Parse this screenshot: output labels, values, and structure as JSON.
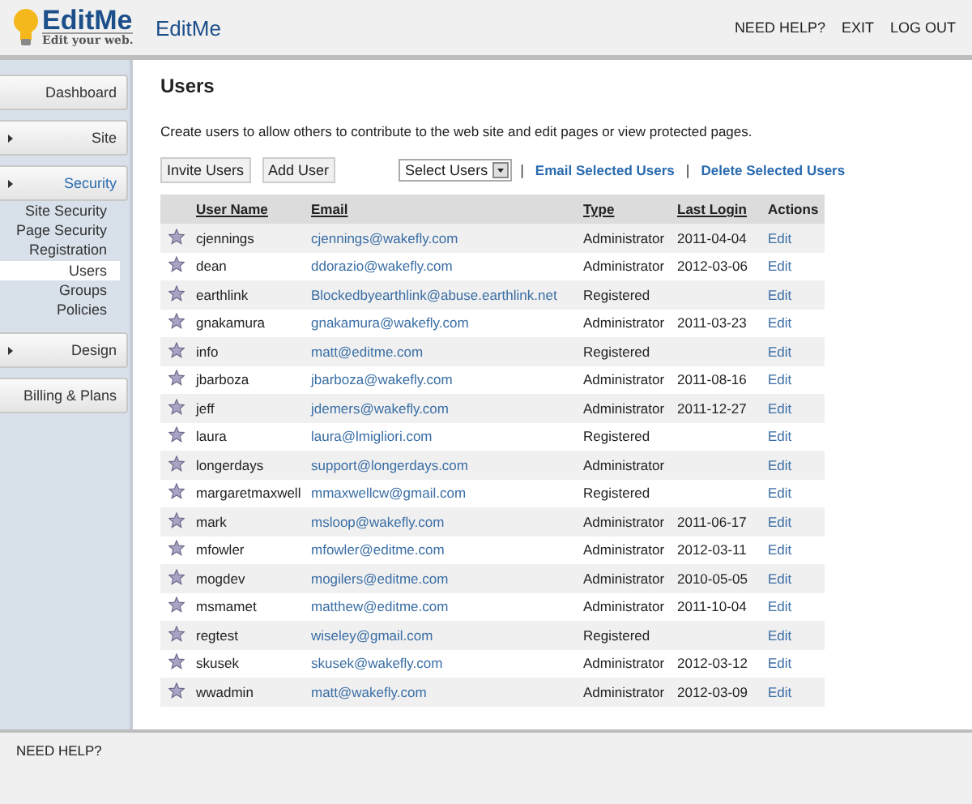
{
  "header": {
    "logo_name": "EditMe",
    "logo_tagline": "Edit your web.",
    "site_title": "EditMe",
    "links": [
      "NEED HELP?",
      "EXIT",
      "LOG OUT"
    ]
  },
  "sidebar": {
    "items": [
      {
        "label": "Dashboard",
        "kind": "link",
        "selected": false
      },
      {
        "label": "Site",
        "kind": "section",
        "selected": false
      },
      {
        "label": "Security",
        "kind": "section",
        "selected": true,
        "children": [
          {
            "label": "Site Security",
            "selected": false
          },
          {
            "label": "Page Security",
            "selected": false
          },
          {
            "label": "Registration",
            "selected": false
          },
          {
            "label": "Users",
            "selected": true
          },
          {
            "label": "Groups",
            "selected": false
          },
          {
            "label": "Policies",
            "selected": false
          }
        ]
      },
      {
        "label": "Design",
        "kind": "section",
        "selected": false
      },
      {
        "label": "Billing & Plans",
        "kind": "link",
        "selected": false
      }
    ]
  },
  "page": {
    "title": "Users",
    "description": "Create users to allow others to contribute to the web site and edit pages or view protected pages.",
    "buttons": [
      "Invite Users",
      "Add User"
    ],
    "select": "Select Users",
    "separators": [
      "|",
      "|"
    ],
    "actions": [
      "Email Selected Users",
      "Delete Selected Users"
    ]
  },
  "table": {
    "columns": [
      {
        "label": "User Name",
        "sortable": true
      },
      {
        "label": "Email",
        "sortable": true
      },
      {
        "label": "Type",
        "sortable": true
      },
      {
        "label": "Last Login",
        "sortable": true
      },
      {
        "label": "Actions",
        "sortable": false
      }
    ],
    "rows": [
      {
        "user": "cjennings",
        "email": "cjennings@wakefly.com",
        "type": "Administrator",
        "last_login": "2011-04-04",
        "action": "Edit"
      },
      {
        "user": "dean",
        "email": "ddorazio@wakefly.com",
        "type": "Administrator",
        "last_login": "2012-03-06",
        "action": "Edit"
      },
      {
        "user": "earthlink",
        "email": "Blockedbyearthlink@abuse.earthlink.net",
        "type": "Registered",
        "action": "Edit"
      },
      {
        "user": "gnakamura",
        "email": "gnakamura@wakefly.com",
        "type": "Administrator",
        "last_login": "2011-03-23",
        "action": "Edit"
      },
      {
        "user": "info",
        "email": "matt@editme.com",
        "type": "Registered",
        "action": "Edit"
      },
      {
        "user": "jbarboza",
        "email": "jbarboza@wakefly.com",
        "type": "Administrator",
        "last_login": "2011-08-16",
        "action": "Edit"
      },
      {
        "user": "jeff",
        "email": "jdemers@wakefly.com",
        "type": "Administrator",
        "last_login": "2011-12-27",
        "action": "Edit"
      },
      {
        "user": "laura",
        "email": "laura@lmigliori.com",
        "type": "Registered",
        "action": "Edit"
      },
      {
        "user": "longerdays",
        "email": "support@longerdays.com",
        "type": "Administrator",
        "action": "Edit"
      },
      {
        "user": "margaretmaxwell",
        "email": "mmaxwellcw@gmail.com",
        "type": "Registered",
        "action": "Edit"
      },
      {
        "user": "mark",
        "email": "msloop@wakefly.com",
        "type": "Administrator",
        "last_login": "2011-06-17",
        "action": "Edit"
      },
      {
        "user": "mfowler",
        "email": "mfowler@editme.com",
        "type": "Administrator",
        "last_login": "2012-03-11",
        "action": "Edit"
      },
      {
        "user": "mogdev",
        "email": "mogilers@editme.com",
        "type": "Administrator",
        "last_login": "2010-05-05",
        "action": "Edit"
      },
      {
        "user": "msmamet",
        "email": "matthew@editme.com",
        "type": "Administrator",
        "last_login": "2011-10-04",
        "action": "Edit"
      },
      {
        "user": "regtest",
        "email": "wiseley@gmail.com",
        "type": "Registered",
        "action": "Edit"
      },
      {
        "user": "skusek",
        "email": "skusek@wakefly.com",
        "type": "Administrator",
        "last_login": "2012-03-12",
        "action": "Edit"
      },
      {
        "user": "wwadmin",
        "email": "matt@wakefly.com",
        "type": "Administrator",
        "last_login": "2012-03-09",
        "action": "Edit"
      }
    ]
  },
  "footer": {
    "help": "NEED HELP?"
  }
}
